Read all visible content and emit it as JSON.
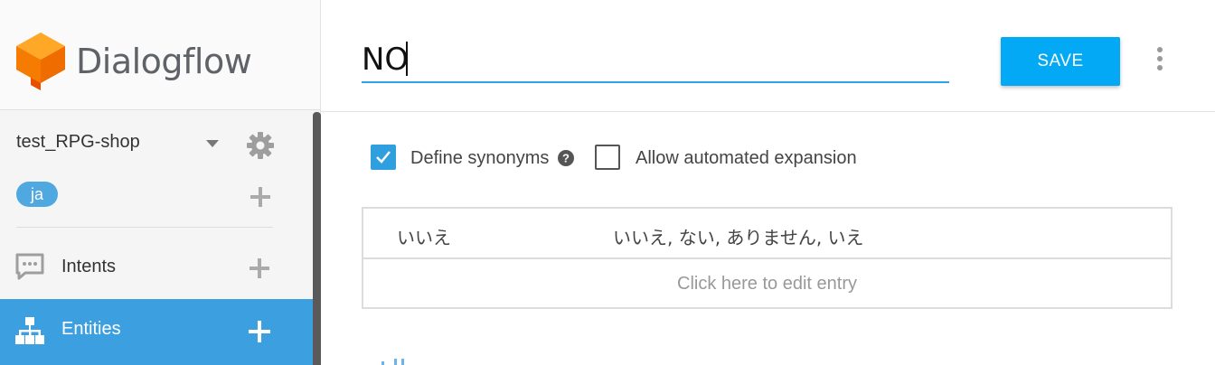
{
  "brand": {
    "name": "Dialogflow",
    "colors": {
      "orange": "#f57c00",
      "blue": "#03a9f4"
    }
  },
  "sidebar": {
    "agent_name": "test_RPG-shop",
    "language": "ja",
    "nav": [
      {
        "label": "Intents",
        "icon": "chat-bubble-icon"
      },
      {
        "label": "Entities",
        "icon": "entity-tree-icon",
        "active": true
      }
    ]
  },
  "header": {
    "entity_name": "NO",
    "save_label": "SAVE"
  },
  "options": {
    "define_synonyms": {
      "label": "Define synonyms",
      "checked": true
    },
    "automated_expansion": {
      "label": "Allow automated expansion",
      "checked": false
    }
  },
  "entries": [
    {
      "reference": "いいえ",
      "synonyms": "いいえ, ない, ありません, いえ"
    }
  ],
  "edit_placeholder": "Click here to edit entry"
}
